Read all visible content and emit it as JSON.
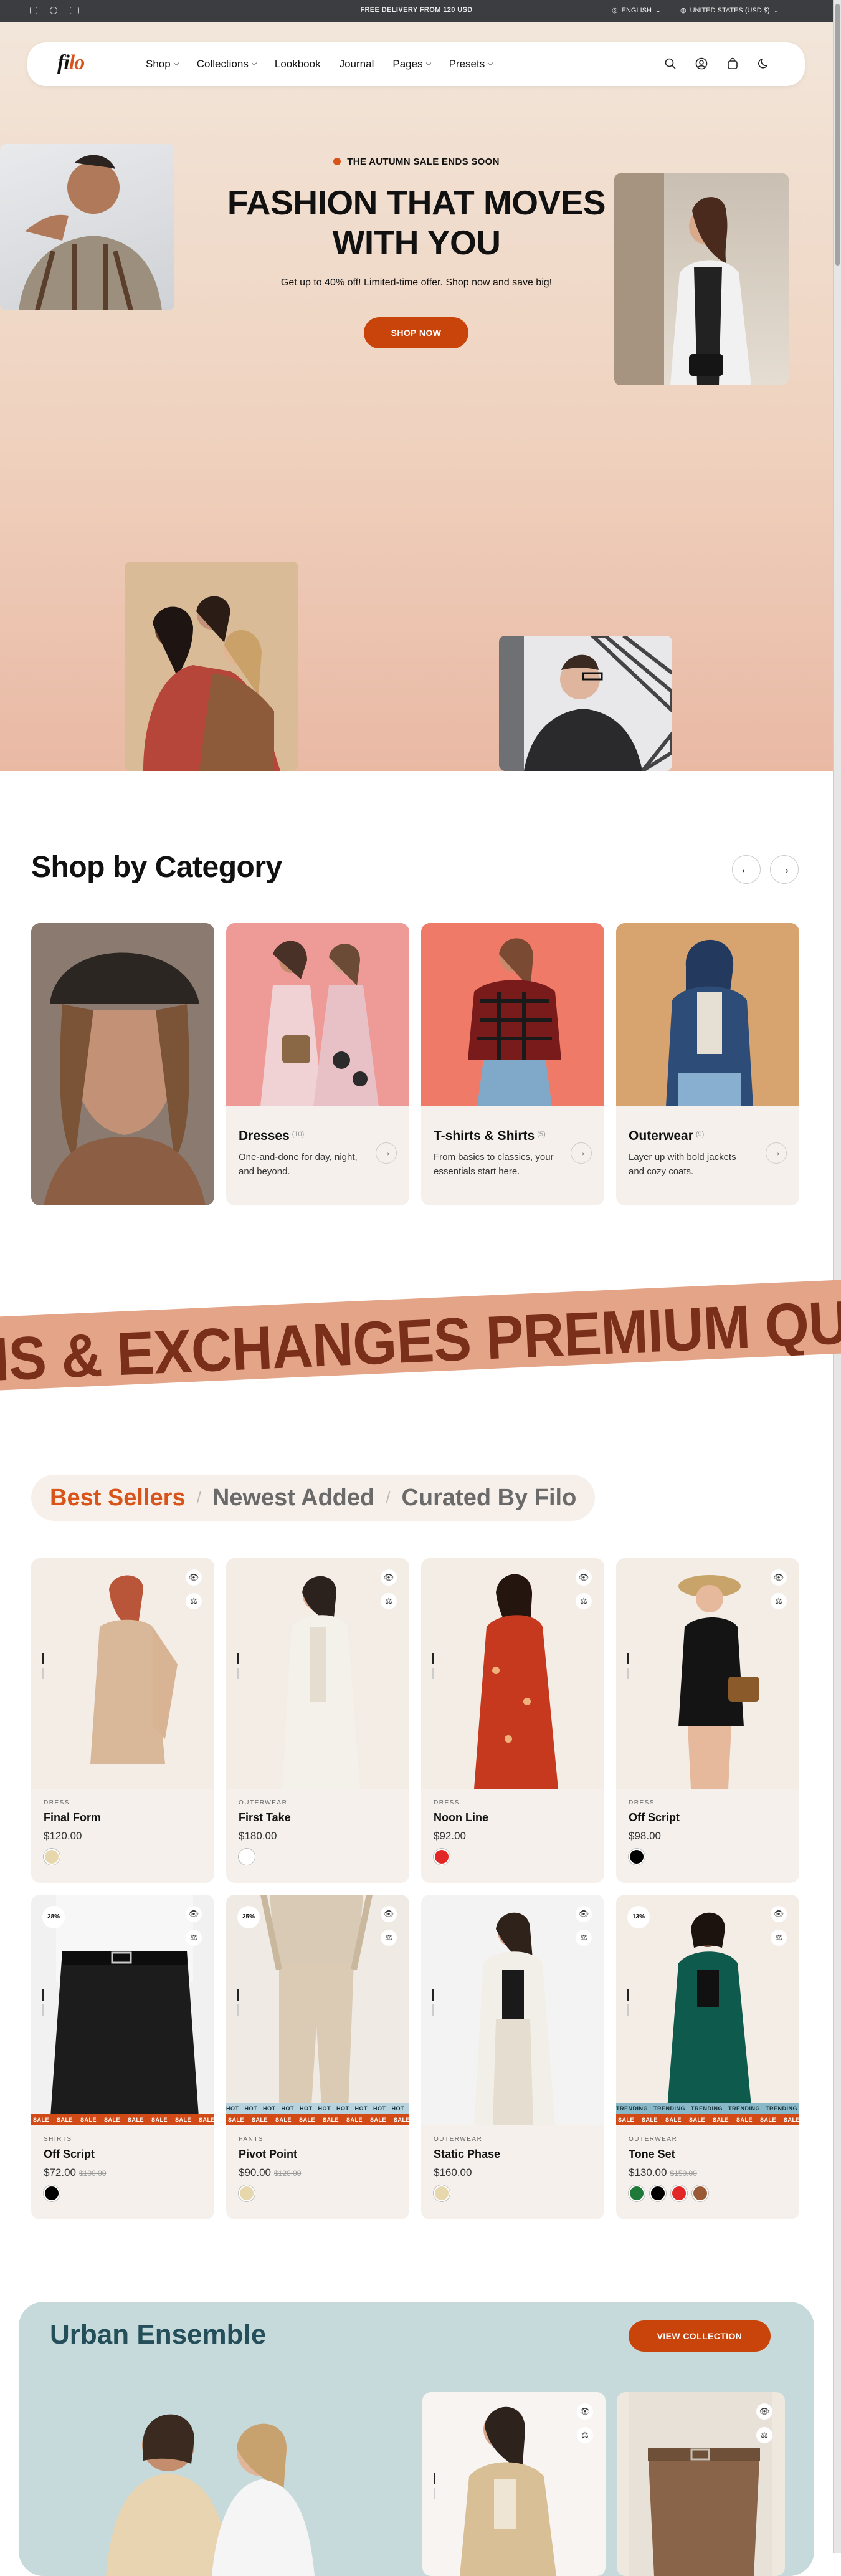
{
  "topbar": {
    "promo": "FREE DELIVERY FROM 120 USD",
    "social": [
      "instagram-icon",
      "facebook-icon",
      "youtube-icon"
    ],
    "language": "ENGLISH",
    "currency": "UNITED STATES (USD $)"
  },
  "nav": {
    "logo_a": "fi",
    "logo_b": "lo",
    "links": [
      "Shop",
      "Collections",
      "Lookbook",
      "Journal",
      "Pages",
      "Presets"
    ],
    "icons": [
      "search-icon",
      "account-icon",
      "cart-icon",
      "dark-mode-icon"
    ]
  },
  "hero": {
    "badge": "THE AUTUMN SALE ENDS SOON",
    "title_1": "FASHION THAT MOVES",
    "title_2": "WITH YOU",
    "subtitle": "Get up to 40% off! Limited-time offer. Shop now and save big!",
    "cta": "SHOP NOW"
  },
  "categories": {
    "title": "Shop by Category",
    "items": [
      {
        "name": "Dresses",
        "count": "(10)",
        "desc": "One-and-done for day, night, and beyond."
      },
      {
        "name": "T-shirts & Shirts",
        "count": "(5)",
        "desc": "From basics to classics, your essentials start here."
      },
      {
        "name": "Outerwear",
        "count": "(9)",
        "desc": "Layer up with bold jackets and cozy coats."
      }
    ]
  },
  "marquee": {
    "text": "NS & EXCHANGES  PREMIUM QU"
  },
  "tabs": {
    "active": "Best Sellers",
    "t2": "Newest Added",
    "t3": "Curated By Filo",
    "sep": "/"
  },
  "products": [
    {
      "type": "DRESS",
      "name": "Final Form",
      "price": "$120.00",
      "old": "",
      "disc": "",
      "swatches": [
        "#e6d7ad"
      ]
    },
    {
      "type": "OUTERWEAR",
      "name": "First Take",
      "price": "$180.00",
      "old": "",
      "disc": "",
      "swatches": [
        "#ffffff"
      ]
    },
    {
      "type": "DRESS",
      "name": "Noon Line",
      "price": "$92.00",
      "old": "",
      "disc": "",
      "swatches": [
        "#e22626"
      ]
    },
    {
      "type": "DRESS",
      "name": "Off Script",
      "price": "$98.00",
      "old": "",
      "disc": "",
      "swatches": [
        "#000000"
      ]
    },
    {
      "type": "SHIRTS",
      "name": "Off Script",
      "price": "$72.00",
      "old": "$100.00",
      "disc": "28%",
      "swatches": [
        "#000000"
      ],
      "ribbon": "SALE"
    },
    {
      "type": "PANTS",
      "name": "Pivot Point",
      "price": "$90.00",
      "old": "$120.00",
      "disc": "25%",
      "swatches": [
        "#e6d7ad"
      ],
      "ribbon": "SALE",
      "ribbon2": "HOT"
    },
    {
      "type": "OUTERWEAR",
      "name": "Static Phase",
      "price": "$160.00",
      "old": "",
      "disc": "",
      "swatches": [
        "#e6d7ad"
      ]
    },
    {
      "type": "OUTERWEAR",
      "name": "Tone Set",
      "price": "$130.00",
      "old": "$150.00",
      "disc": "13%",
      "swatches": [
        "#1f7a3a",
        "#000000",
        "#e22626",
        "#9b5a36"
      ],
      "ribbon": "SALE",
      "ribbon2": "TRENDING"
    }
  ],
  "urban": {
    "title": "Urban Ensemble",
    "cta": "VIEW COLLECTION"
  },
  "colors": {
    "accent": "#d8541b",
    "button": "#c9440b",
    "card_bg": "#f5f0eb"
  }
}
